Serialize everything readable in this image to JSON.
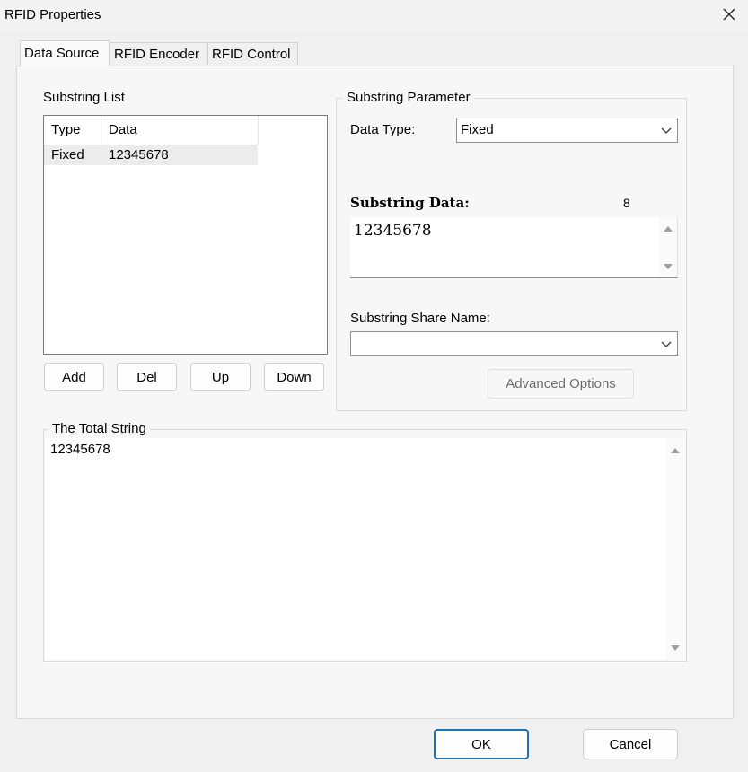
{
  "window": {
    "title": "RFID Properties"
  },
  "tabs": [
    {
      "label": "Data Source"
    },
    {
      "label": "RFID Encoder"
    },
    {
      "label": "RFID Control"
    }
  ],
  "substring_list": {
    "label": "Substring List",
    "columns": [
      "Type",
      "Data"
    ],
    "rows": [
      {
        "type": "Fixed",
        "data": "12345678"
      }
    ],
    "buttons": {
      "add": "Add",
      "del": "Del",
      "up": "Up",
      "down": "Down"
    }
  },
  "substring_parameter": {
    "title": "Substring Parameter",
    "data_type_label": "Data Type:",
    "data_type_value": "Fixed",
    "substring_data_label": "Substring Data:",
    "substring_data_count": "8",
    "substring_data_value": "12345678",
    "share_name_label": "Substring Share Name:",
    "share_name_value": "",
    "advanced_button": "Advanced Options"
  },
  "total_string": {
    "title": "The Total String",
    "value": "12345678"
  },
  "footer": {
    "ok": "OK",
    "cancel": "Cancel"
  }
}
